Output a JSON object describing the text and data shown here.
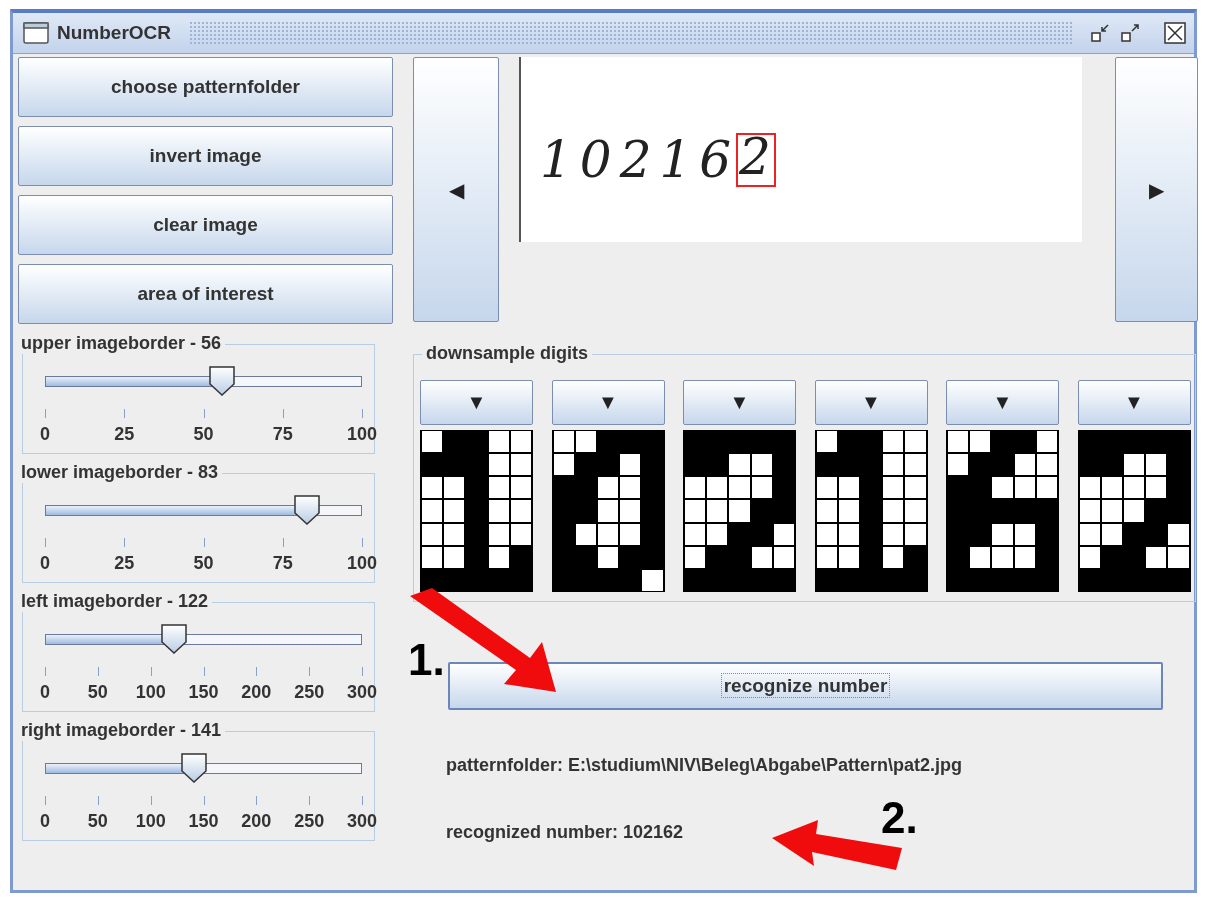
{
  "window": {
    "title": "NumberOCR"
  },
  "left_buttons": [
    "choose patternfolder",
    "invert image",
    "clear image",
    "area of interest"
  ],
  "sliders": [
    {
      "title": "upper imageborder - 56",
      "level": 0.56,
      "ticks": [
        "0",
        "25",
        "50",
        "75",
        "100"
      ]
    },
    {
      "title": "lower imageborder - 83",
      "level": 0.83,
      "ticks": [
        "0",
        "25",
        "50",
        "75",
        "100"
      ]
    },
    {
      "title": "left imageborder - 122",
      "level": 0.4067,
      "ticks": [
        "0",
        "50",
        "100",
        "150",
        "200",
        "250",
        "300"
      ]
    },
    {
      "title": "right imageborder - 141",
      "level": 0.47,
      "ticks": [
        "0",
        "50",
        "100",
        "150",
        "200",
        "250",
        "300"
      ]
    }
  ],
  "image_nav": {
    "prev": "◀",
    "next": "▶"
  },
  "handwritten_digits": [
    {
      "text": "1",
      "selected": false
    },
    {
      "text": "0",
      "selected": false
    },
    {
      "text": "2",
      "selected": false
    },
    {
      "text": "1",
      "selected": false
    },
    {
      "text": "6",
      "selected": false
    },
    {
      "text": "2",
      "selected": true
    }
  ],
  "downsample": {
    "title": "downsample digits",
    "digits": [
      {
        "button": "▼",
        "cells": [
          [
            true,
            false,
            false,
            true,
            true
          ],
          [
            false,
            false,
            false,
            true,
            true
          ],
          [
            true,
            true,
            false,
            true,
            true
          ],
          [
            true,
            true,
            false,
            true,
            true
          ],
          [
            true,
            true,
            false,
            true,
            true
          ],
          [
            true,
            true,
            false,
            true,
            false
          ],
          [
            false,
            false,
            false,
            false,
            false
          ]
        ]
      },
      {
        "button": "▼",
        "cells": [
          [
            true,
            true,
            false,
            false,
            false
          ],
          [
            true,
            false,
            false,
            true,
            false
          ],
          [
            false,
            false,
            true,
            true,
            false
          ],
          [
            false,
            false,
            true,
            true,
            false
          ],
          [
            false,
            true,
            true,
            true,
            false
          ],
          [
            false,
            false,
            true,
            false,
            false
          ],
          [
            false,
            false,
            false,
            false,
            true
          ]
        ]
      },
      {
        "button": "▼",
        "cells": [
          [
            false,
            false,
            false,
            false,
            false
          ],
          [
            false,
            false,
            true,
            true,
            false
          ],
          [
            true,
            true,
            true,
            true,
            false
          ],
          [
            true,
            true,
            true,
            false,
            false
          ],
          [
            true,
            true,
            false,
            false,
            true
          ],
          [
            true,
            false,
            false,
            true,
            true
          ],
          [
            false,
            false,
            false,
            false,
            false
          ]
        ]
      },
      {
        "button": "▼",
        "cells": [
          [
            true,
            false,
            false,
            true,
            true
          ],
          [
            false,
            false,
            false,
            true,
            true
          ],
          [
            true,
            true,
            false,
            true,
            true
          ],
          [
            true,
            true,
            false,
            true,
            true
          ],
          [
            true,
            true,
            false,
            true,
            true
          ],
          [
            true,
            true,
            false,
            true,
            false
          ],
          [
            false,
            false,
            false,
            false,
            false
          ]
        ]
      },
      {
        "button": "▼",
        "cells": [
          [
            true,
            true,
            false,
            false,
            true
          ],
          [
            true,
            false,
            false,
            true,
            true
          ],
          [
            false,
            false,
            true,
            true,
            true
          ],
          [
            false,
            false,
            false,
            false,
            false
          ],
          [
            false,
            false,
            true,
            true,
            false
          ],
          [
            false,
            true,
            true,
            true,
            false
          ],
          [
            false,
            false,
            false,
            false,
            false
          ]
        ]
      },
      {
        "button": "▼",
        "cells": [
          [
            false,
            false,
            false,
            false,
            false
          ],
          [
            false,
            false,
            true,
            true,
            false
          ],
          [
            true,
            true,
            true,
            true,
            false
          ],
          [
            true,
            true,
            true,
            false,
            false
          ],
          [
            true,
            true,
            false,
            false,
            true
          ],
          [
            true,
            false,
            false,
            true,
            true
          ],
          [
            false,
            false,
            false,
            false,
            false
          ]
        ]
      }
    ]
  },
  "recognize_button": "recognize number",
  "patternfolder_text": "patternfolder: E:\\studium\\NIV\\Beleg\\Abgabe\\Pattern\\pat2.jpg",
  "result_text": "recognized number: 102162",
  "annotations": [
    {
      "label": "1.",
      "kind": "arrow"
    },
    {
      "label": "2.",
      "kind": "arrow"
    }
  ]
}
